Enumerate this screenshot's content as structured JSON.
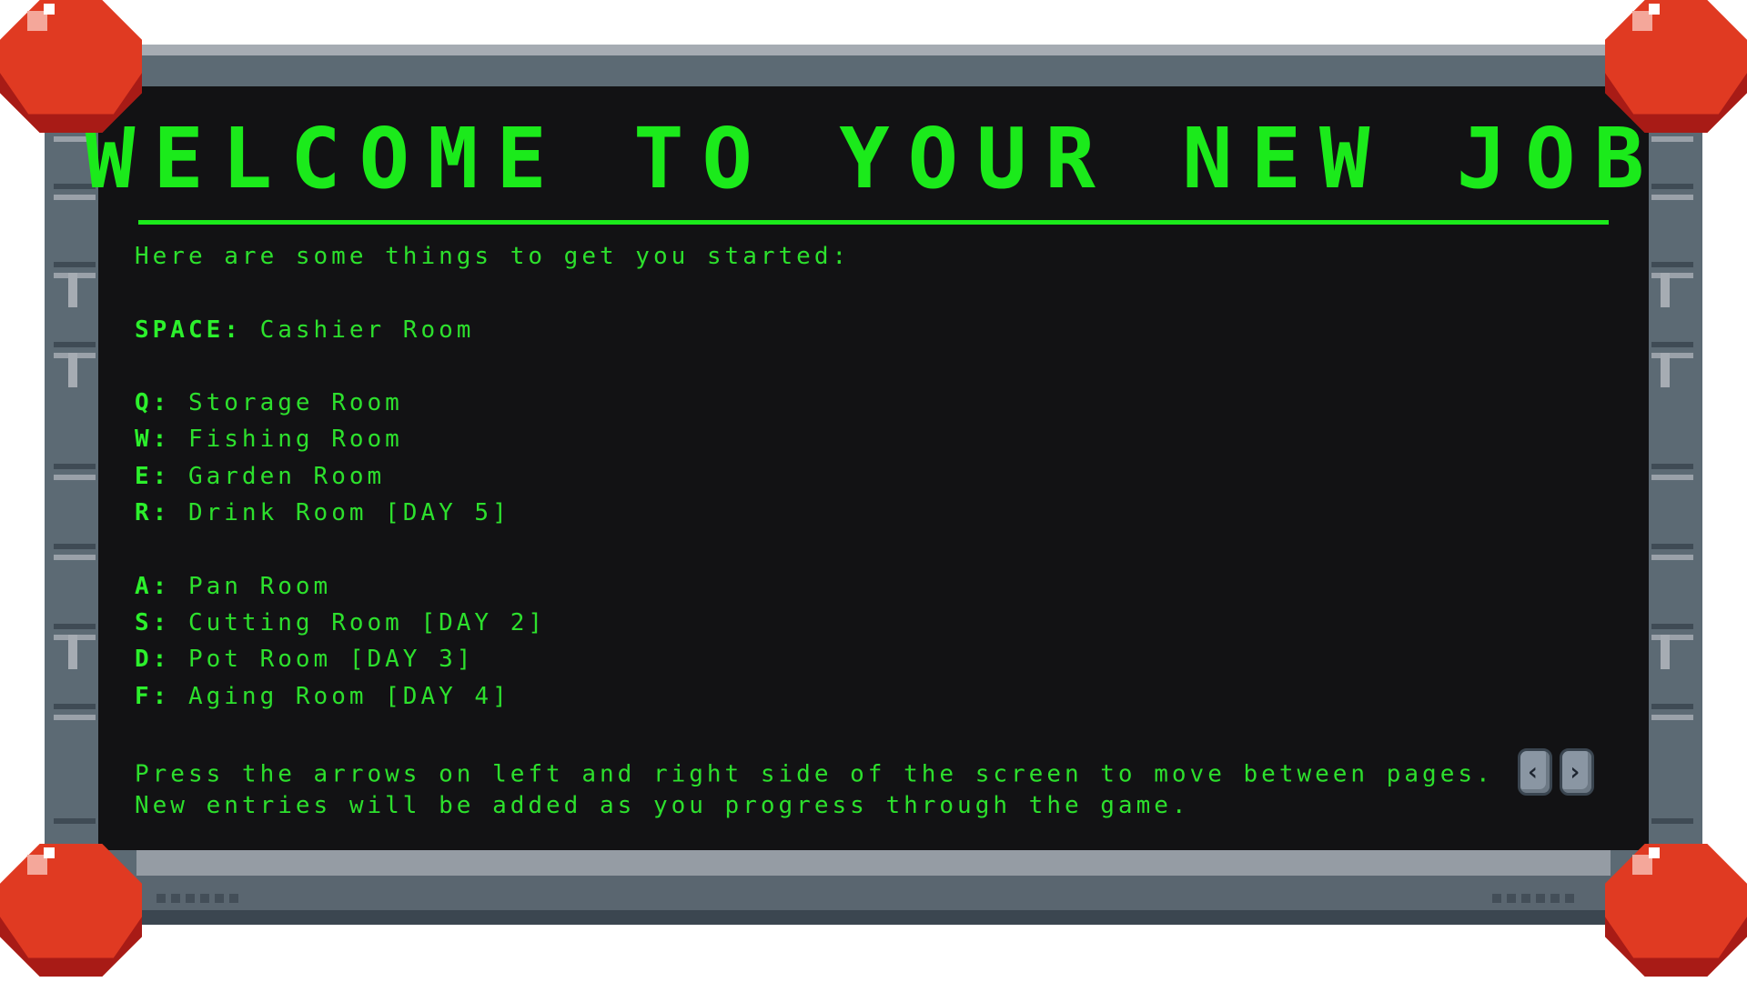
{
  "title": "WELCOME TO YOUR NEW JOB",
  "intro": "Here are some things to get you started:",
  "space_entry": {
    "key": "SPACE:",
    "label": " Cashier Room"
  },
  "group1": [
    {
      "key": "Q:",
      "label": " Storage Room"
    },
    {
      "key": "W:",
      "label": " Fishing Room"
    },
    {
      "key": "E:",
      "label": " Garden Room"
    },
    {
      "key": "R:",
      "label": " Drink Room [DAY 5]"
    }
  ],
  "group2": [
    {
      "key": "A:",
      "label": " Pan Room"
    },
    {
      "key": "S:",
      "label": " Cutting Room [DAY 2]"
    },
    {
      "key": "D:",
      "label": " Pot Room [DAY 3]"
    },
    {
      "key": "F:",
      "label": " Aging Room [DAY 4]"
    }
  ],
  "footer": {
    "line1": "Press the arrows on left and right side of the screen to move between pages.",
    "line2": "New entries will be added as you progress through the game."
  },
  "icons": {
    "left_arrow": "left-arrow-icon",
    "right_arrow": "right-arrow-icon"
  },
  "colors": {
    "terminal_green": "#1bea1b",
    "screen_bg": "#121214",
    "bolt_red": "#e03a22",
    "frame_steel": "#5c6a74"
  }
}
